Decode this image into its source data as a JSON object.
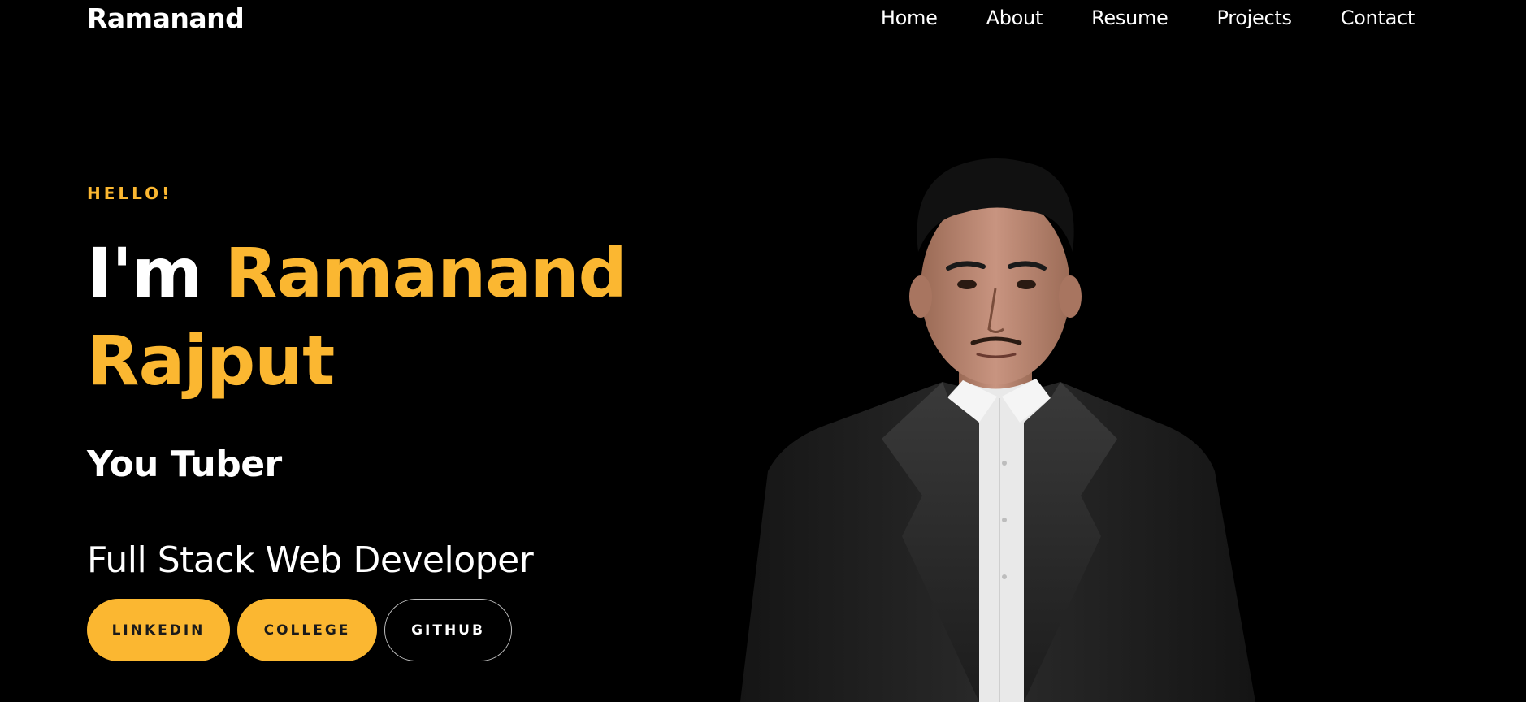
{
  "header": {
    "brand": "Ramanand",
    "nav": [
      "Home",
      "About",
      "Resume",
      "Projects",
      "Contact"
    ]
  },
  "hero": {
    "greeting": "HELLO!",
    "intro": "I'm",
    "name": "Ramanand Rajput",
    "typed_role": "You Tuber",
    "subtitle": "Full Stack Web Developer",
    "buttons": {
      "linkedin": "LINKEDIN",
      "college": "COLLEGE",
      "github": "GITHUB"
    }
  },
  "colors": {
    "accent": "#fbb731",
    "background": "#000000",
    "text": "#ffffff"
  }
}
